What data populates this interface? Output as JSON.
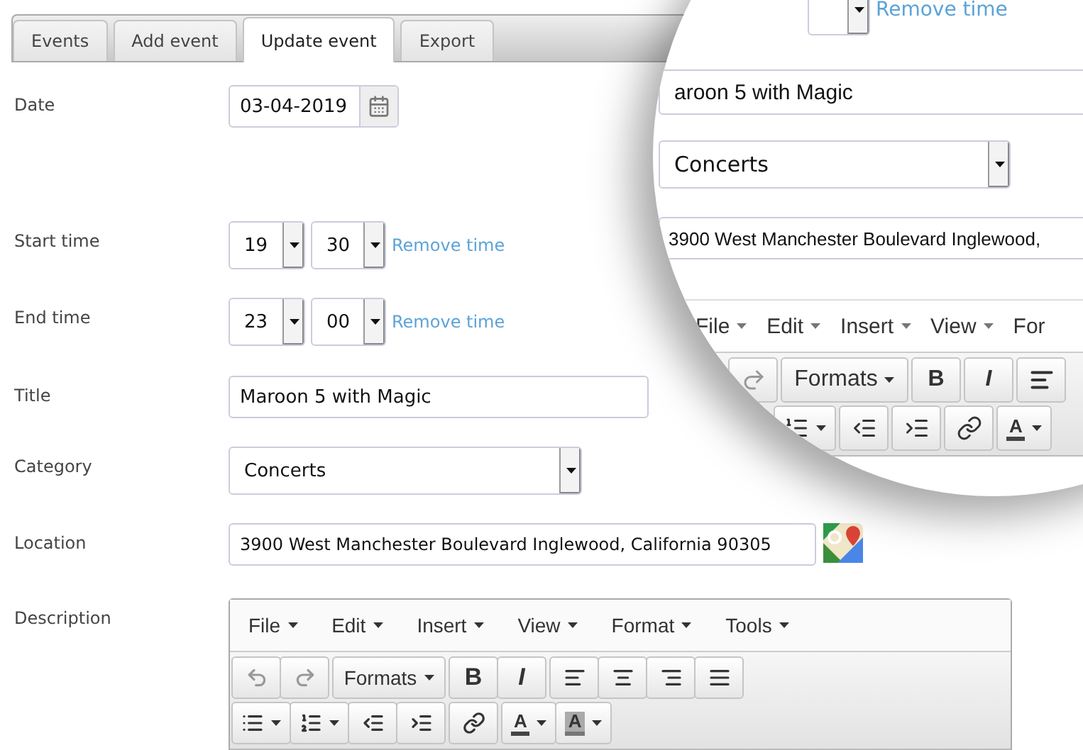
{
  "tabs": [
    {
      "label": "Events",
      "selected": false
    },
    {
      "label": "Add event",
      "selected": false
    },
    {
      "label": "Update event",
      "selected": true
    },
    {
      "label": "Export",
      "selected": false
    }
  ],
  "form": {
    "date": {
      "label": "Date",
      "value": "03-04-2019"
    },
    "start_time": {
      "label": "Start time",
      "hour": "19",
      "minute": "30",
      "remove_link": "Remove time"
    },
    "end_time": {
      "label": "End time",
      "hour": "23",
      "minute": "00",
      "remove_link": "Remove time"
    },
    "title": {
      "label": "Title",
      "value": "Maroon 5 with Magic"
    },
    "category": {
      "label": "Category",
      "value": "Concerts"
    },
    "location": {
      "label": "Location",
      "value": "3900 West Manchester Boulevard Inglewood, California 90305"
    },
    "description": {
      "label": "Description"
    }
  },
  "editor": {
    "menus": [
      "File",
      "Edit",
      "Insert",
      "View",
      "Format",
      "Tools"
    ],
    "formats_button": "Formats",
    "bold_label": "B",
    "italic_label": "I",
    "text_color_label": "A",
    "background_color_label": "A",
    "undo": {
      "disabled": true
    },
    "redo": {
      "disabled": true
    }
  },
  "magnifier": {
    "remove_link": "Remove time",
    "title": "aroon 5 with Magic",
    "category": "Concerts",
    "location": "3900 West Manchester Boulevard Inglewood,",
    "menus": [
      "File",
      "Edit",
      "Insert",
      "View",
      "For"
    ],
    "formats_button": "Formats",
    "bold_label": "B",
    "italic_label": "I",
    "text_color_label": "A"
  }
}
